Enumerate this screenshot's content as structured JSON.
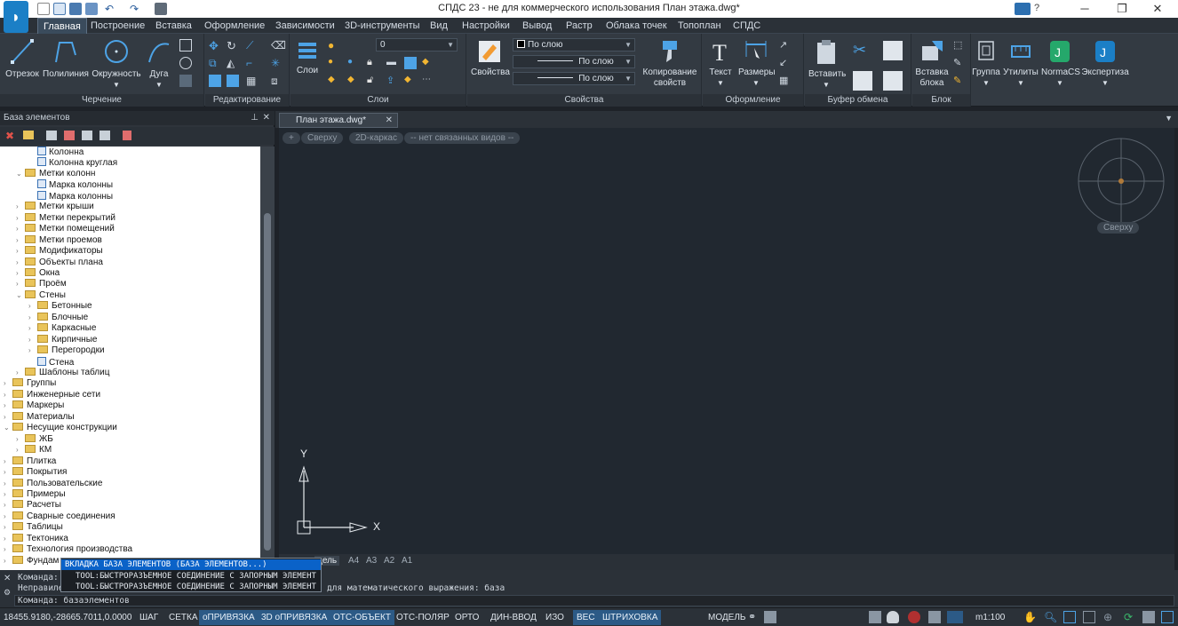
{
  "window": {
    "title": "СПДС 23 - не для коммерческого использования План этажа.dwg*"
  },
  "menu": {
    "tabs": [
      "Главная",
      "Построение",
      "Вставка",
      "Оформление",
      "Зависимости",
      "3D-инструменты",
      "Вид",
      "Настройки",
      "Вывод",
      "Растр",
      "Облака точек",
      "Топоплан",
      "СПДС"
    ],
    "active": "Главная"
  },
  "ribbon": {
    "draw": {
      "title": "Черчение",
      "line": "Отрезок",
      "polyline": "Полилиния",
      "circle": "Окружность",
      "arc": "Дуга"
    },
    "edit": {
      "title": "Редактирование"
    },
    "layers": {
      "title": "Слои",
      "layers_btn": "Слои",
      "layer_value": "0"
    },
    "props": {
      "title": "Свойства",
      "props_btn": "Свойства",
      "color": "По слою",
      "linetype": "По слою",
      "lineweight": "По слою",
      "copy_props_1": "Копирование",
      "copy_props_2": "свойств"
    },
    "annot": {
      "title": "Оформление",
      "text": "Текст",
      "dims": "Размеры"
    },
    "clipboard": {
      "title": "Буфер обмена",
      "paste": "Вставить"
    },
    "block": {
      "title": "Блок",
      "insert_1": "Вставка",
      "insert_2": "блока"
    },
    "group": "Группа",
    "utils": "Утилиты",
    "normacs": "NormaCS",
    "expert": "Экспертиза"
  },
  "palette": {
    "title": "База элементов",
    "tree": [
      {
        "label": "Колонна",
        "level": 3,
        "kind": "leaf"
      },
      {
        "label": "Колонна круглая",
        "level": 3,
        "kind": "leaf"
      },
      {
        "label": "Метки колонн",
        "level": 2,
        "kind": "folder-open"
      },
      {
        "label": "Марка колонны",
        "level": 3,
        "kind": "leaf"
      },
      {
        "label": "Марка колонны",
        "level": 3,
        "kind": "leaf"
      },
      {
        "label": "Метки крыши",
        "level": 2,
        "kind": "folder"
      },
      {
        "label": "Метки перекрытий",
        "level": 2,
        "kind": "folder"
      },
      {
        "label": "Метки помещений",
        "level": 2,
        "kind": "folder"
      },
      {
        "label": "Метки проемов",
        "level": 2,
        "kind": "folder"
      },
      {
        "label": "Модификаторы",
        "level": 2,
        "kind": "folder"
      },
      {
        "label": "Объекты плана",
        "level": 2,
        "kind": "folder"
      },
      {
        "label": "Окна",
        "level": 2,
        "kind": "folder"
      },
      {
        "label": "Проём",
        "level": 2,
        "kind": "folder"
      },
      {
        "label": "Стены",
        "level": 2,
        "kind": "folder-open"
      },
      {
        "label": "Бетонные",
        "level": 3,
        "kind": "folder"
      },
      {
        "label": "Блочные",
        "level": 3,
        "kind": "folder"
      },
      {
        "label": "Каркасные",
        "level": 3,
        "kind": "folder"
      },
      {
        "label": "Кирпичные",
        "level": 3,
        "kind": "folder"
      },
      {
        "label": "Перегородки",
        "level": 3,
        "kind": "folder"
      },
      {
        "label": "Стена",
        "level": 3,
        "kind": "leaf"
      },
      {
        "label": "Шаблоны таблиц",
        "level": 2,
        "kind": "folder"
      },
      {
        "label": "Группы",
        "level": 1,
        "kind": "folder"
      },
      {
        "label": "Инженерные сети",
        "level": 1,
        "kind": "folder"
      },
      {
        "label": "Маркеры",
        "level": 1,
        "kind": "folder"
      },
      {
        "label": "Материалы",
        "level": 1,
        "kind": "folder"
      },
      {
        "label": "Несущие конструкции",
        "level": 1,
        "kind": "folder-open"
      },
      {
        "label": "ЖБ",
        "level": 2,
        "kind": "folder"
      },
      {
        "label": "КМ",
        "level": 2,
        "kind": "folder"
      },
      {
        "label": "Плитка",
        "level": 1,
        "kind": "folder"
      },
      {
        "label": "Покрытия",
        "level": 1,
        "kind": "folder"
      },
      {
        "label": "Пользовательские",
        "level": 1,
        "kind": "folder"
      },
      {
        "label": "Примеры",
        "level": 1,
        "kind": "folder"
      },
      {
        "label": "Расчеты",
        "level": 1,
        "kind": "folder"
      },
      {
        "label": "Сварные соединения",
        "level": 1,
        "kind": "folder"
      },
      {
        "label": "Таблицы",
        "level": 1,
        "kind": "folder"
      },
      {
        "label": "Тектоника",
        "level": 1,
        "kind": "folder"
      },
      {
        "label": "Технология производства",
        "level": 1,
        "kind": "folder"
      },
      {
        "label": "Фундам",
        "level": 1,
        "kind": "folder"
      }
    ]
  },
  "document": {
    "tab": "План этажа.dwg*",
    "view_plus": "+",
    "view": "Сверху",
    "visual_style": "2D-каркас",
    "named_views": "-- нет связанных видов --",
    "viewcube_label": "Сверху",
    "axis_x": "X",
    "axis_y": "Y",
    "layouts": [
      "дель",
      "A4",
      "A3",
      "A2",
      "A1"
    ]
  },
  "autocomplete": [
    "ВКЛАДКА БАЗА ЭЛЕМЕНТОВ (БАЗА ЭЛЕМЕНТОВ...)",
    "TOOL:БЫСТРОРАЗЪЕМНОЕ СОЕДИНЕНИЕ С ЗАПОРНЫМ ЭЛЕМЕНТ",
    "TOOL:БЫСТРОРАЗЪЕМНОЕ СОЕДИНЕНИЕ С ЗАПОРНЫМ ЭЛЕМЕНТ"
  ],
  "command": {
    "line1": "Команда:",
    "line2_prefix": "Неправиле",
    "line2_suffix": "для математического выражения: база",
    "input": "Команда: базаэлементов"
  },
  "status": {
    "coords": "18455.9180,-28665.7011,0.0000",
    "buttons": [
      {
        "label": "ШАГ",
        "on": false
      },
      {
        "label": "СЕТКА",
        "on": false
      },
      {
        "label": "оПРИВЯЗКА",
        "on": true
      },
      {
        "label": "3D оПРИВЯЗКА",
        "on": true
      },
      {
        "label": "ОТС-ОБЪЕКТ",
        "on": true
      },
      {
        "label": "ОТС-ПОЛЯР",
        "on": false
      },
      {
        "label": "ОРТО",
        "on": false
      },
      {
        "label": "ДИН-ВВОД",
        "on": false
      },
      {
        "label": "ИЗО",
        "on": false
      },
      {
        "label": "ВЕС",
        "on": true
      },
      {
        "label": "ШТРИХОВКА",
        "on": true
      }
    ],
    "model": "МОДЕЛЬ",
    "scale": "m1:100"
  },
  "colors": {
    "accent": "#1b7fc6",
    "folder": "#e9c45a",
    "canvas": "#212830",
    "active_toggle": "#2c5a86"
  }
}
